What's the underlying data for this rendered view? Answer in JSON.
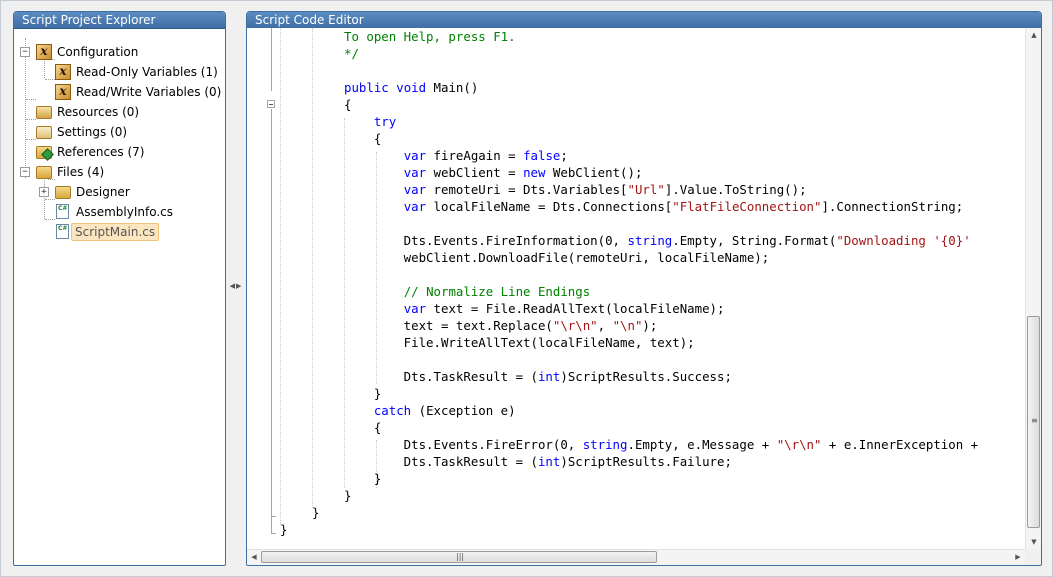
{
  "explorer": {
    "title": "Script Project Explorer",
    "items": [
      {
        "label": "Configuration",
        "icon": "variables-icon",
        "expander": "−"
      },
      {
        "label": "Read-Only Variables (1)",
        "icon": "variables-icon"
      },
      {
        "label": "Read/Write Variables (0)",
        "icon": "variables-icon"
      },
      {
        "label": "Resources (0)",
        "icon": "resources-icon"
      },
      {
        "label": "Settings (0)",
        "icon": "settings-icon"
      },
      {
        "label": "References (7)",
        "icon": "references-icon"
      },
      {
        "label": "Files (4)",
        "icon": "folder-icon",
        "expander": "−"
      },
      {
        "label": "Designer",
        "icon": "folder-icon",
        "expander": "+"
      },
      {
        "label": "AssemblyInfo.cs",
        "icon": "csharp-file-icon"
      },
      {
        "label": "ScriptMain.cs",
        "icon": "csharp-file-icon",
        "selected": true
      }
    ]
  },
  "editor": {
    "title": "Script Code Editor",
    "lines": [
      [
        {
          "t": "To open Help, press F1.",
          "c": "cm"
        }
      ],
      [
        {
          "t": "*/",
          "c": "cm"
        }
      ],
      [],
      [
        {
          "t": "public",
          "c": "kw"
        },
        {
          "t": " "
        },
        {
          "t": "void",
          "c": "kw"
        },
        {
          "t": " Main()"
        }
      ],
      [
        {
          "t": "{"
        }
      ],
      [
        {
          "t": "    "
        },
        {
          "t": "try",
          "c": "kw"
        }
      ],
      [
        {
          "t": "    {"
        }
      ],
      [
        {
          "t": "        "
        },
        {
          "t": "var",
          "c": "kw"
        },
        {
          "t": " fireAgain = "
        },
        {
          "t": "false",
          "c": "kw"
        },
        {
          "t": ";"
        }
      ],
      [
        {
          "t": "        "
        },
        {
          "t": "var",
          "c": "kw"
        },
        {
          "t": " webClient = "
        },
        {
          "t": "new",
          "c": "kw"
        },
        {
          "t": " WebClient();"
        }
      ],
      [
        {
          "t": "        "
        },
        {
          "t": "var",
          "c": "kw"
        },
        {
          "t": " remoteUri = Dts.Variables["
        },
        {
          "t": "\"Url\"",
          "c": "str"
        },
        {
          "t": "].Value.ToString();"
        }
      ],
      [
        {
          "t": "        "
        },
        {
          "t": "var",
          "c": "kw"
        },
        {
          "t": " localFileName = Dts.Connections["
        },
        {
          "t": "\"FlatFileConnection\"",
          "c": "str"
        },
        {
          "t": "].ConnectionString;"
        }
      ],
      [],
      [
        {
          "t": "        Dts.Events.FireInformation(0, "
        },
        {
          "t": "string",
          "c": "kw"
        },
        {
          "t": ".Empty, String.Format("
        },
        {
          "t": "\"Downloading '{0}'",
          "c": "str"
        }
      ],
      [
        {
          "t": "        webClient.DownloadFile(remoteUri, localFileName);"
        }
      ],
      [],
      [
        {
          "t": "        "
        },
        {
          "t": "// Normalize Line Endings",
          "c": "cm"
        }
      ],
      [
        {
          "t": "        "
        },
        {
          "t": "var",
          "c": "kw"
        },
        {
          "t": " text = File.ReadAllText(localFileName);"
        }
      ],
      [
        {
          "t": "        text = text.Replace("
        },
        {
          "t": "\"\\r\\n\"",
          "c": "str"
        },
        {
          "t": ", "
        },
        {
          "t": "\"\\n\"",
          "c": "str"
        },
        {
          "t": ");"
        }
      ],
      [
        {
          "t": "        File.WriteAllText(localFileName, text);"
        }
      ],
      [],
      [
        {
          "t": "        Dts.TaskResult = ("
        },
        {
          "t": "int",
          "c": "kw"
        },
        {
          "t": ")ScriptResults.Success;"
        }
      ],
      [
        {
          "t": "    }"
        }
      ],
      [
        {
          "t": "    "
        },
        {
          "t": "catch",
          "c": "kw"
        },
        {
          "t": " (Exception e)"
        }
      ],
      [
        {
          "t": "    {"
        }
      ],
      [
        {
          "t": "        Dts.Events.FireError(0, "
        },
        {
          "t": "string",
          "c": "kw"
        },
        {
          "t": ".Empty, e.Message + "
        },
        {
          "t": "\"\\r\\n\"",
          "c": "str"
        },
        {
          "t": " + e.InnerException +"
        }
      ],
      [
        {
          "t": "        Dts.TaskResult = ("
        },
        {
          "t": "int",
          "c": "kw"
        },
        {
          "t": ")ScriptResults.Failure;"
        }
      ],
      [
        {
          "t": "    }"
        }
      ],
      [
        {
          "t": "}"
        }
      ],
      [
        {
          "t": "}",
          "indent": "class"
        }
      ],
      [
        {
          "t": "}",
          "indent": "ns"
        }
      ]
    ]
  },
  "colors": {
    "header": "#3f6ea6",
    "keyword": "#0000ff",
    "comment": "#008000",
    "string": "#a31515",
    "selection": "#fce6c0"
  }
}
